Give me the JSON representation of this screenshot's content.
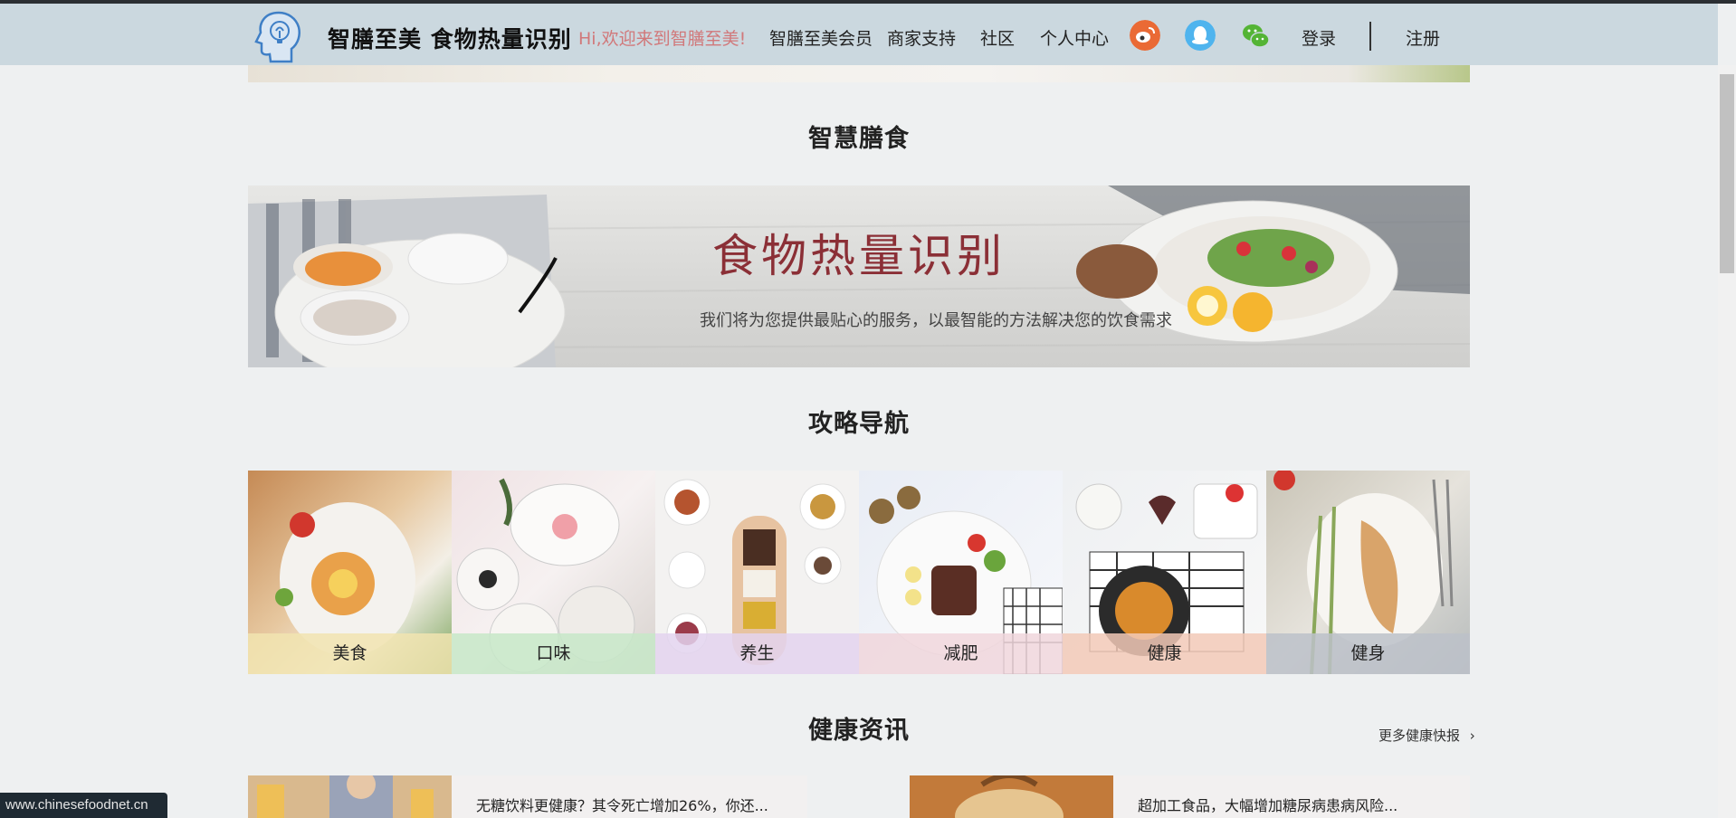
{
  "header": {
    "brand": "智膳至美 食物热量识别",
    "welcome": "Hi,欢迎来到智膳至美!",
    "nav": [
      "智膳至美会员",
      "商家支持",
      "社区",
      "个人中心"
    ],
    "social_icons": [
      "weibo-icon",
      "qq-icon",
      "wechat-icon"
    ],
    "login": "登录",
    "register": "注册"
  },
  "sections": {
    "smart_diet": "智慧膳食",
    "guide_nav": "攻略导航",
    "health_news": "健康资讯"
  },
  "hero": {
    "title": "食物热量识别",
    "subtitle": "我们将为您提供最贴心的服务，以最智能的方法解决您的饮食需求"
  },
  "tiles": [
    {
      "label": "美食",
      "overlay": "#f1e4b0"
    },
    {
      "label": "口味",
      "overlay": "#c7e7c8"
    },
    {
      "label": "养生",
      "overlay": "#e3d3ee"
    },
    {
      "label": "减肥",
      "overlay": "#f0d6dc"
    },
    {
      "label": "健康",
      "overlay": "#f2c9b7"
    },
    {
      "label": "健身",
      "overlay": "#bcc1c9"
    }
  ],
  "more_link": "更多健康快报",
  "news": [
    {
      "title": "无糖饮料更健康？其令死亡增加26%，你还..."
    },
    {
      "title": "超加工食品，大幅增加糖尿病患病风险..."
    }
  ],
  "watermark": "www.chinesefoodnet.cn",
  "colors": {
    "navbar": "#cbd8df",
    "welcome": "#d1787a",
    "hero_title": "#8b2f36",
    "page_bg": "#eef0f1"
  }
}
